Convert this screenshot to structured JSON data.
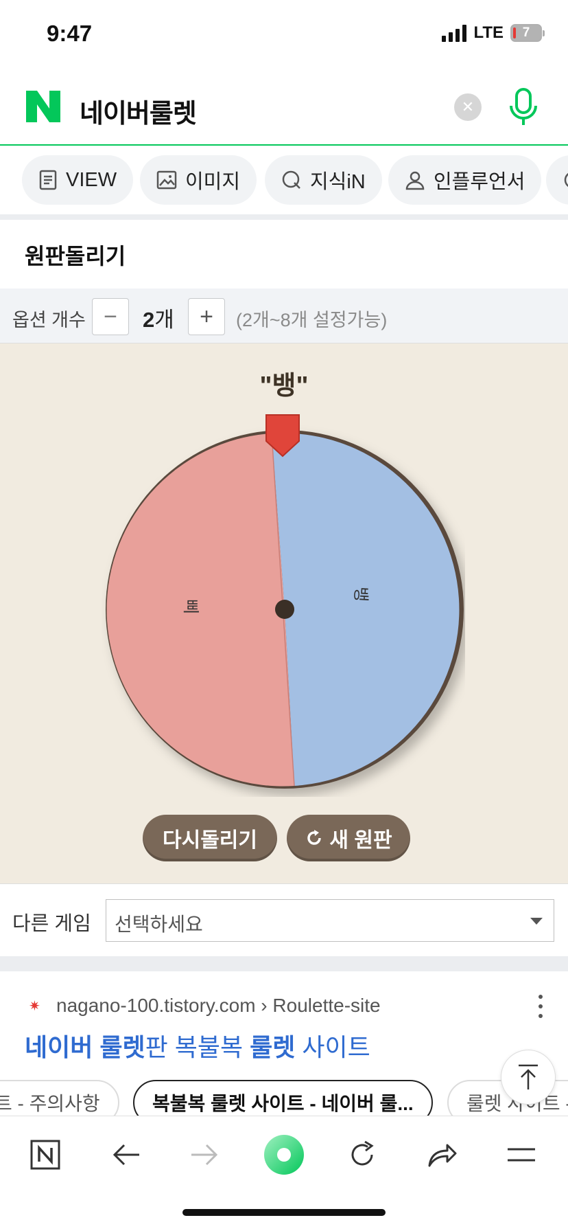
{
  "status_bar": {
    "time": "9:47",
    "network": "LTE",
    "battery": "7"
  },
  "search": {
    "query": "네이버룰렛"
  },
  "tabs": [
    {
      "label": "VIEW",
      "icon": "document-icon"
    },
    {
      "label": "이미지",
      "icon": "image-icon"
    },
    {
      "label": "지식iN",
      "icon": "q-icon"
    },
    {
      "label": "인플루언서",
      "icon": "person-icon"
    }
  ],
  "roulette": {
    "section_title": "원판돌리기",
    "options_label": "옵션 개수",
    "option_count": "2",
    "count_unit": "개",
    "range_note": "(2개~8개 설정가능)",
    "result": "\"뱅\"",
    "slices": [
      {
        "label": "삐",
        "color": "#e8a09a"
      },
      {
        "label": "뱅",
        "color": "#a3bfe3"
      }
    ],
    "spin_again_label": "다시돌리기",
    "new_wheel_label": "새 원판"
  },
  "other_game": {
    "label": "다른 게임",
    "select_value": "선택하세요"
  },
  "result_item": {
    "source": "nagano-100.tistory.com › Roulette-site",
    "title_parts": [
      "네이버 룰렛",
      "판 복불복 ",
      "룰렛",
      " 사이트"
    ],
    "chips": [
      "트 - 주의사항",
      "복불복 룰렛 사이트 - 네이버 룰...",
      "룰렛 사이트 -"
    ]
  },
  "colors": {
    "naver_green": "#03c75a",
    "link_blue": "#2f6bd0",
    "wheel_bg": "#f1ebe0",
    "button_brown": "#7a6858",
    "pointer_red": "#e0453a"
  }
}
